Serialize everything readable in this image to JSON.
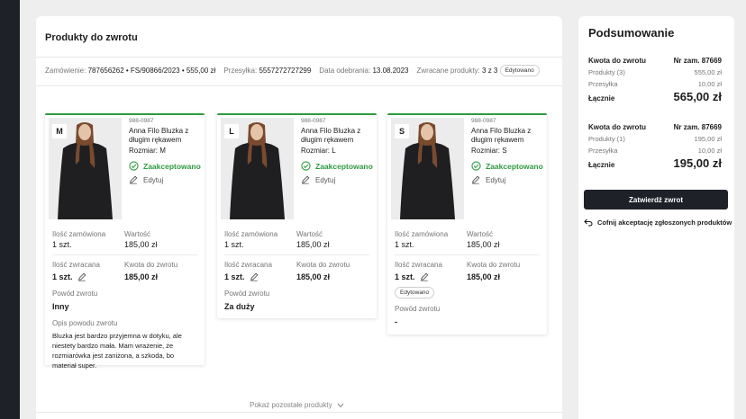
{
  "main": {
    "title": "Produkty do zwrotu",
    "meta": {
      "order_label": "Zamówienie:",
      "order_value": "787656262 • FS/90866/2023 • 555,00 zł",
      "shipment_label": "Przesyłka:",
      "shipment_value": "5557272727299",
      "received_label": "Data odebrania:",
      "received_value": "13.08.2023",
      "returned_label": "Zwracane produkty:",
      "returned_value": "3 z 3",
      "edited_badge": "Edytowano"
    },
    "labels": {
      "ordered_qty": "Ilość zamówiona",
      "value": "Wartość",
      "returned_qty": "Ilość zwracana",
      "refund_amount": "Kwota do zwrotu",
      "reason": "Powód zwrotu",
      "reason_desc": "Opis powodu zwrotu",
      "edit": "Edytuj",
      "edited": "Edytowano"
    },
    "cards": [
      {
        "size_badge": "M",
        "sku": "988-0987",
        "name": "Anna Filo Bluzka z długim rękawem",
        "size": "Rozmiar: M",
        "status": "Zaakceptowano",
        "ordered_qty": "1 szt.",
        "value": "185,00 zł",
        "returned_qty": "1 szt.",
        "refund_amount": "185,00 zł",
        "reason": "Inny",
        "reason_desc": "Bluzka jest bardzo przyjemna w dotyku, ale niestety bardzo mała. Mam wrażenie, że rozmiarówka jest zaniżona, a szkoda, bo materiał super."
      },
      {
        "size_badge": "L",
        "sku": "988-0987",
        "name": "Anna Filo Bluzka z długim rękawem",
        "size": "Rozmiar: L",
        "status": "Zaakceptowano",
        "ordered_qty": "1 szt.",
        "value": "185,00 zł",
        "returned_qty": "1 szt.",
        "refund_amount": "185,00 zł",
        "reason": "Za duży"
      },
      {
        "size_badge": "S",
        "sku": "988-0987",
        "name": "Anna Filo Bluzka z długim rękawem",
        "size": "Rozmiar: S",
        "status": "Zaakceptowano",
        "ordered_qty": "1 szt.",
        "value": "185,00 zł",
        "returned_qty": "1 szt.",
        "refund_amount": "185,00 zł",
        "reason": "-"
      }
    ],
    "show_more": "Pokaż pozostałe produkty"
  },
  "summary": {
    "title": "Podsumowanie",
    "blocks": [
      {
        "refund_label": "Kwota do zwrotu",
        "order_no": "Nr zam. 87669",
        "products_label": "Produkty (3)",
        "products_value": "555,00 zł",
        "shipping_label": "Przesyłka",
        "shipping_value": "10,00 zł",
        "total_label": "Łącznie",
        "total_value": "565,00 zł"
      },
      {
        "refund_label": "Kwota do zwrotu",
        "order_no": "Nr zam. 87669",
        "products_label": "Produkty (1)",
        "products_value": "195,00 zł",
        "shipping_label": "Przesyłka",
        "shipping_value": "10,00 zł",
        "total_label": "Łącznie",
        "total_value": "195,00 zł"
      }
    ],
    "confirm_button": "Zatwierdź zwrot",
    "undo_link": "Cofnij akceptację zgłoszonych produktów"
  },
  "colors": {
    "accent_green": "#2e9b3f",
    "dark": "#1e2128"
  }
}
